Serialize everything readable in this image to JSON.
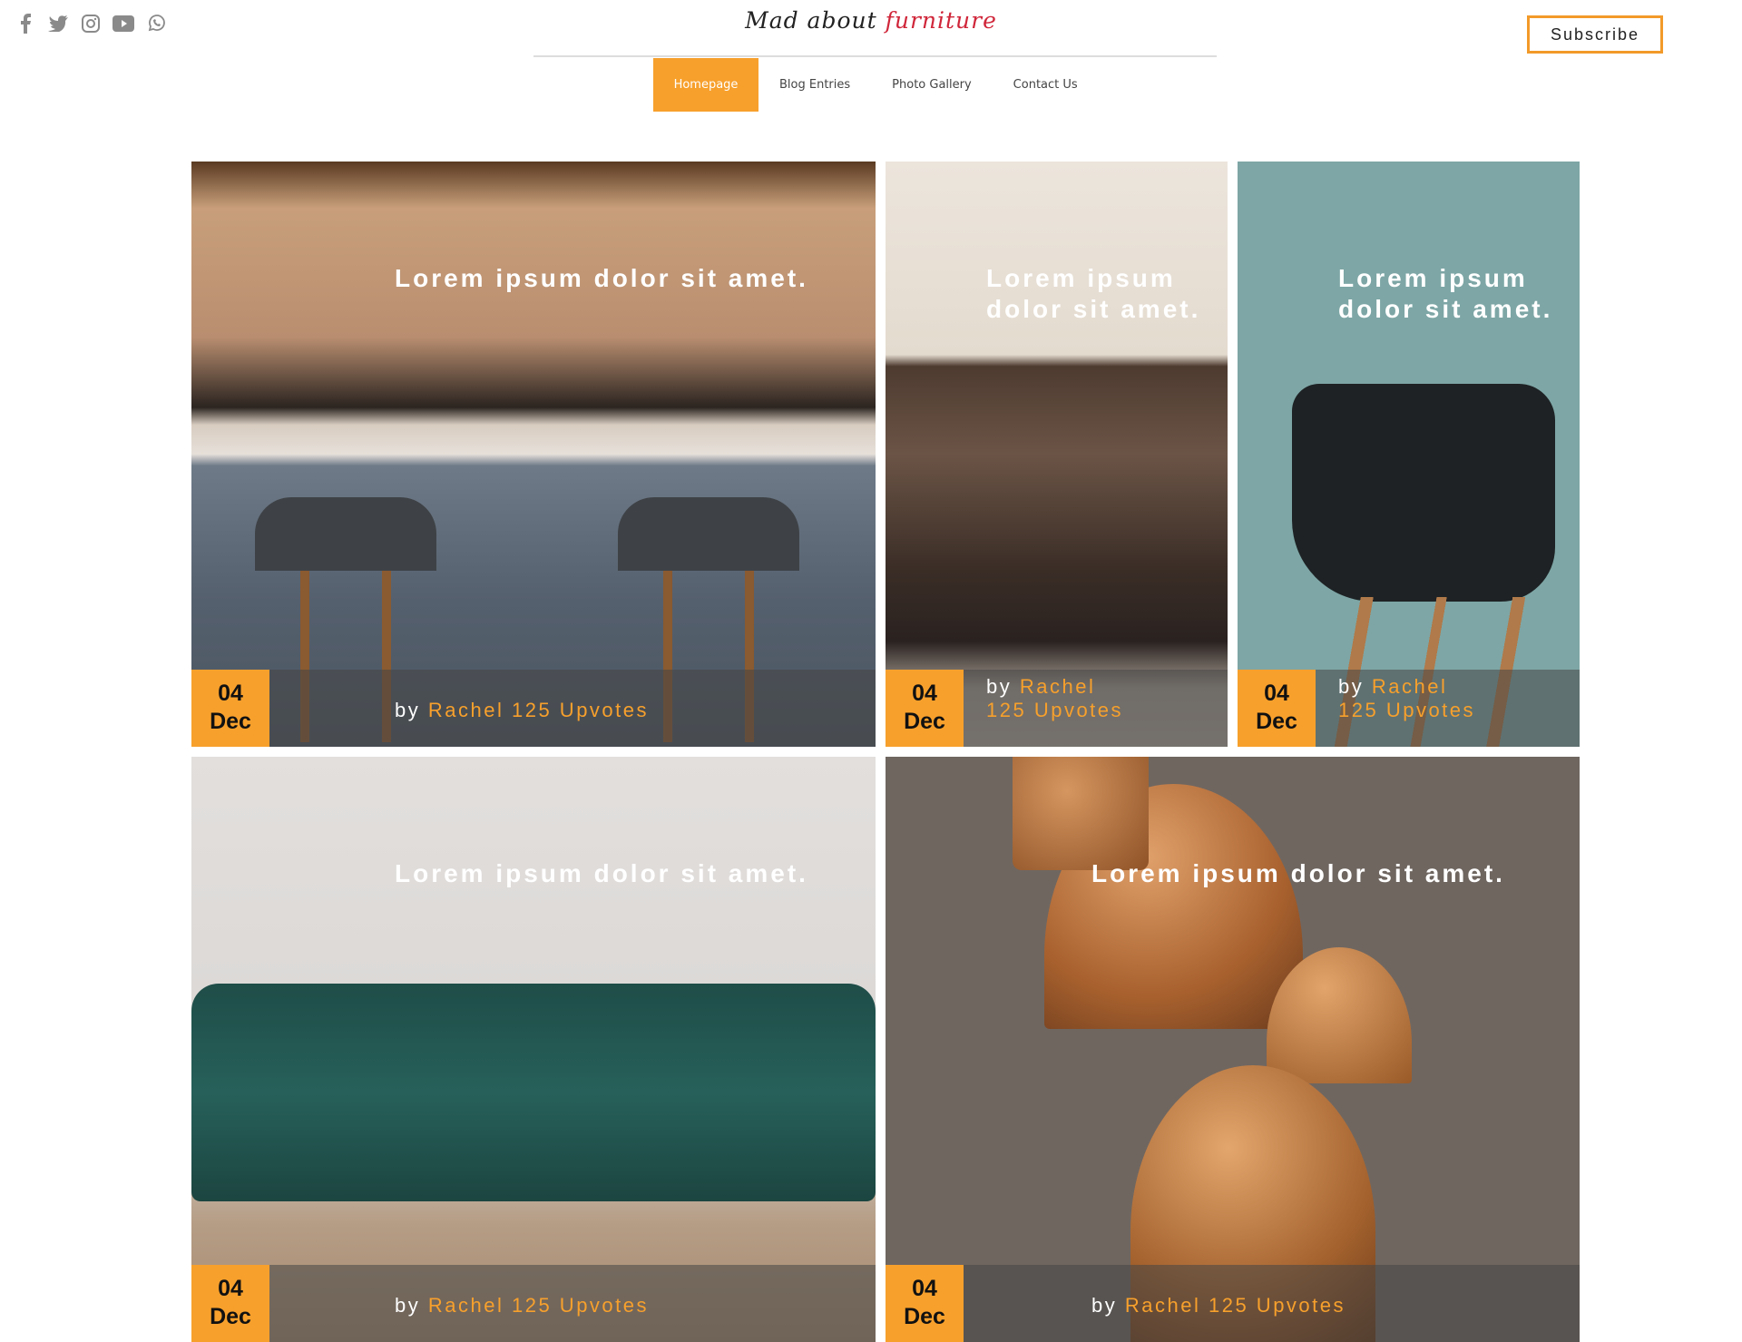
{
  "header": {
    "social": [
      "facebook-icon",
      "twitter-icon",
      "instagram-icon",
      "youtube-icon",
      "whatsapp-icon"
    ],
    "logo": {
      "part1": "Mad about ",
      "part2": "furniture"
    },
    "subscribe_label": "Subscribe",
    "nav": [
      {
        "label": "Homepage",
        "active": true
      },
      {
        "label": "Blog Entries"
      },
      {
        "label": "Photo Gallery"
      },
      {
        "label": "Contact Us"
      }
    ]
  },
  "accent": "#f7a02c",
  "posts": [
    {
      "title": "Lorem ipsum dolor sit amet.",
      "day": "04",
      "month": "Dec",
      "by": "by",
      "author": "Rachel",
      "upvotes": "125 Upvotes"
    },
    {
      "title": "Lorem ipsum dolor sit amet.",
      "day": "04",
      "month": "Dec",
      "by": "by",
      "author": "Rachel",
      "upvotes": "125 Upvotes"
    },
    {
      "title": "Lorem ipsum dolor sit amet.",
      "day": "04",
      "month": "Dec",
      "by": "by",
      "author": "Rachel",
      "upvotes": "125 Upvotes"
    },
    {
      "title": "Lorem ipsum dolor sit amet.",
      "day": "04",
      "month": "Dec",
      "by": "by",
      "author": "Rachel",
      "upvotes": "125 Upvotes"
    },
    {
      "title": "Lorem ipsum dolor sit amet.",
      "day": "04",
      "month": "Dec",
      "by": "by",
      "author": "Rachel",
      "upvotes": "125 Upvotes"
    }
  ]
}
